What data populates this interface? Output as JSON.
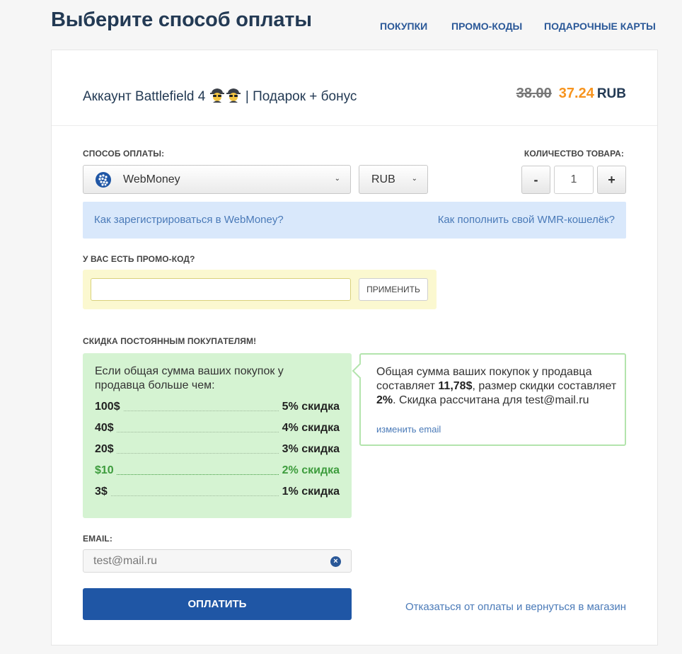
{
  "header": {
    "title": "Выберите способ оплаты",
    "nav": [
      "ПОКУПКИ",
      "ПРОМО-КОДЫ",
      "ПОДАРОЧНЫЕ КАРТЫ"
    ]
  },
  "product": {
    "title_before": "Аккаунт Battlefield 4",
    "title_after": "| Подарок + бонус",
    "price_old": "38.00",
    "price_new": "37.24",
    "currency": "RUB"
  },
  "payment": {
    "label": "СПОСОБ ОПЛАТЫ:",
    "method": "WebMoney",
    "currency": "RUB",
    "qty_label": "КОЛИЧЕСТВО ТОВАРА:",
    "qty_minus": "-",
    "qty_value": "1",
    "qty_plus": "+"
  },
  "info": {
    "register_link": "Как зарегистрироваться в WebMoney?",
    "topup_link": "Как пополнить свой WMR-кошелёк?"
  },
  "promo": {
    "label": "У ВАС ЕСТЬ ПРОМО-КОД?",
    "value": "",
    "apply_button": "ПРИМЕНИТЬ"
  },
  "discount": {
    "label": "СКИДКА ПОСТОЯННЫМ ПОКУПАТЕЛЯМ!",
    "intro": "Если общая сумма ваших покупок у продавца больше чем:",
    "tiers": [
      {
        "amount": "100$",
        "percent": "5% скидка"
      },
      {
        "amount": "40$",
        "percent": "4% скидка"
      },
      {
        "amount": "20$",
        "percent": "3% скидка"
      },
      {
        "amount": "$10",
        "percent": "2% скидка"
      },
      {
        "amount": "3$",
        "percent": "1% скидка"
      }
    ],
    "summary": {
      "p1": "Общая сумма ваших покупок у продавца составляет ",
      "total": "11,78$",
      "p2": ", размер скидки составляет ",
      "rate": "2%",
      "p3": ". Скидка рассчитана для test@mail.ru",
      "change_email": "изменить email"
    }
  },
  "email": {
    "label": "EMAIL:",
    "value": "test@mail.ru"
  },
  "actions": {
    "pay_button": "ОПЛАТИТЬ",
    "cancel_link": "Отказаться от оплаты и вернуться в магазин"
  },
  "colors": {
    "accent": "#f7941e",
    "brand": "#1f56a5",
    "active_tier": "#3d9c3d"
  }
}
